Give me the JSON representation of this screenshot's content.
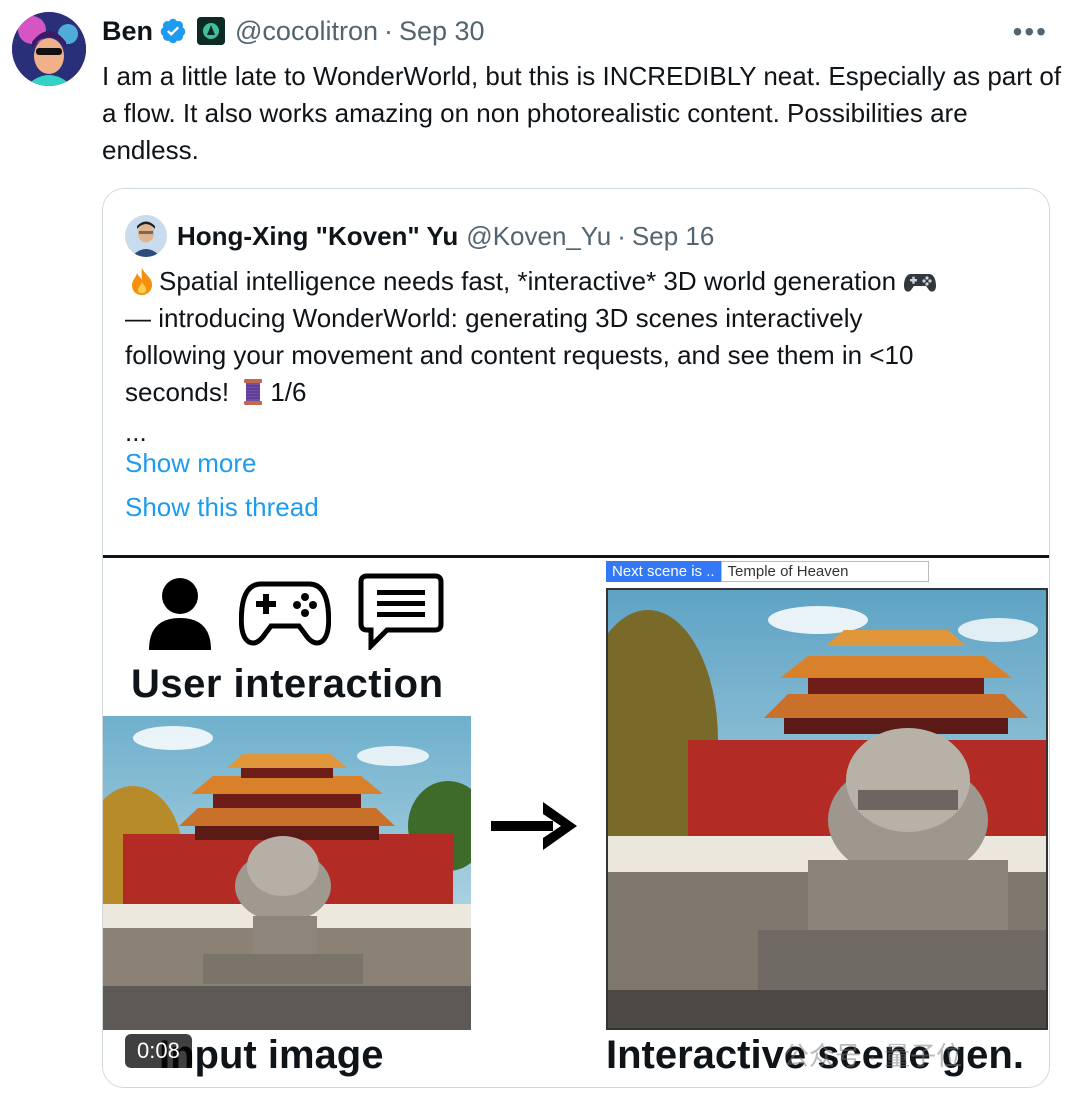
{
  "tweet": {
    "author": "Ben",
    "handle": "@cocolitron",
    "separator": "·",
    "date": "Sep 30",
    "more_label": "•••",
    "text": "I am a little late to WonderWorld, but this is INCREDIBLY neat. Especially as part of a flow. It also works amazing on non photorealistic content. Possibilities are endless."
  },
  "quote": {
    "author": "Hong-Xing \"Koven\" Yu",
    "handle": "@Koven_Yu",
    "separator": "·",
    "date": "Sep 16",
    "line1_a": "Spatial intelligence needs fast, *interactive* 3D world generation",
    "line2": "— introducing WonderWorld: generating 3D scenes interactively",
    "line3": "following your movement and content requests, and see them in <10",
    "line4_a": "seconds!",
    "line4_b": "1/6",
    "ellipsis": "...",
    "show_more": "Show more",
    "show_thread": "Show this thread"
  },
  "media": {
    "user_interaction_label": "User interaction",
    "input_caption": "Input image",
    "gen_caption": "Interactive scene gen.",
    "next_scene_label": "Next scene is ..",
    "next_scene_value": "Temple of Heaven",
    "duration": "0:08",
    "watermark": "公众号 · 量子位"
  },
  "icons": {
    "verified": "verified-badge-icon",
    "more": "more-options-icon",
    "user": "user-icon",
    "gamepad": "gamepad-icon",
    "chat": "chat-bubble-icon",
    "arrow": "arrow-right-icon"
  },
  "colors": {
    "link": "#1d9bf0",
    "verified": "#1d9bf0",
    "secondary_text": "#536471",
    "border": "#cfd9de"
  }
}
